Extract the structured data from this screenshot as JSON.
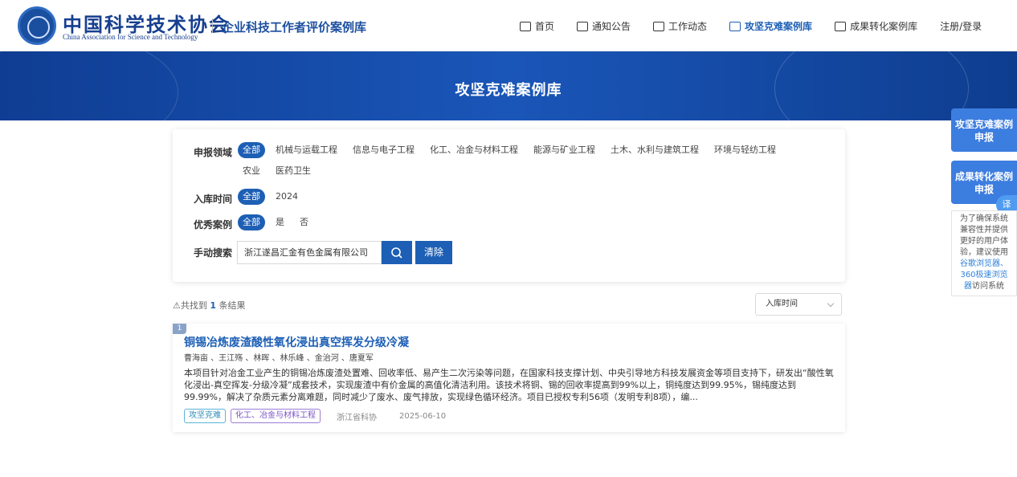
{
  "header": {
    "org_cn": "中国科学技术协会",
    "org_en": "China Association for Science and Technology",
    "site_title": "企业科技工作者评价案例库",
    "nav": [
      {
        "label": "首页",
        "icon": "home-icon"
      },
      {
        "label": "通知公告",
        "icon": "message-icon"
      },
      {
        "label": "工作动态",
        "icon": "chat-icon"
      },
      {
        "label": "攻坚克难案例库",
        "icon": "document-icon",
        "active": true
      },
      {
        "label": "成果转化案例库",
        "icon": "calculator-icon"
      }
    ],
    "login": "注册/登录"
  },
  "banner": {
    "title": "攻坚克难案例库"
  },
  "filters": {
    "field": {
      "label": "申报领域",
      "options": [
        "全部",
        "机械与运载工程",
        "信息与电子工程",
        "化工、冶金与材料工程",
        "能源与矿业工程",
        "土木、水利与建筑工程",
        "环境与轻纺工程",
        "农业",
        "医药卫生"
      ],
      "selected": "全部"
    },
    "year": {
      "label": "入库时间",
      "options": [
        "全部",
        "2024"
      ],
      "selected": "全部"
    },
    "excellent": {
      "label": "优秀案例",
      "options": [
        "全部",
        "是",
        "否"
      ],
      "selected": "全部"
    },
    "search": {
      "label": "手动搜索",
      "value": "浙江遂昌汇金有色金属有限公司",
      "clear": "清除"
    }
  },
  "results": {
    "count_prefix": "共找到",
    "count": "1",
    "count_suffix": "条结果",
    "sort": "入库时间"
  },
  "card": {
    "index": "1",
    "title": "铜锡冶炼废渣酸性氧化浸出真空挥发分级冷凝",
    "authors": "曹海亩 、王江殇 、林晖 、林乐峰 、金治河 、唐夏军",
    "abstract": "本项目针对冶金工业产生的铜锡冶炼废渣处置难、回收率低、易产生二次污染等问题，在国家科技支撑计划、中央引导地方科技发展资金等项目支持下，研发出“酸性氧化浸出-真空挥发-分级冷凝”成套技术，实现废渣中有价金属的高值化清洁利用。该技术将铜、锡的回收率提高到99%以上，铜纯度达到99.95%，锡纯度达到99.99%，解决了杂质元素分离难题，同时减少了废水、废气排放，实现绿色循环经济。项目已授权专利56项（发明专利8项），编...",
    "tag1": "攻坚克难",
    "tag2": "化工、冶金与材料工程",
    "org": "浙江省科协",
    "date": "2025-06-10"
  },
  "side": {
    "btn1": "攻坚克难案例申报",
    "btn2": "成果转化案例申报",
    "translate": "译",
    "notice_text": "为了确保系统兼容性并提供更好的用户体验，建议使用",
    "notice_links": "谷歌浏览器、360极速浏览器",
    "notice_tail": "访问系统"
  }
}
